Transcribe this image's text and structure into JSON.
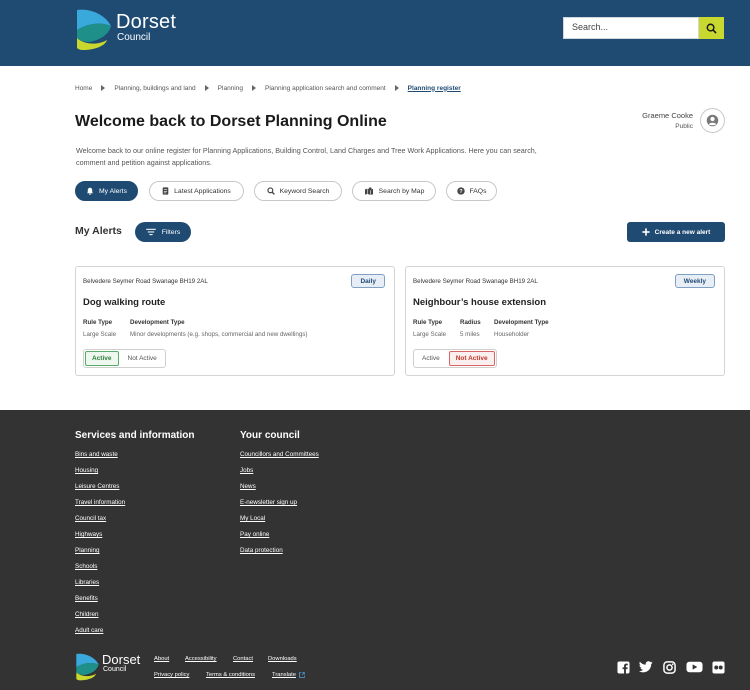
{
  "header": {
    "logo_word1": "Dorset",
    "logo_word2": "Council",
    "search_placeholder": "Search...",
    "search_icon": "search-icon"
  },
  "breadcrumb": [
    "Home",
    "Planning, buildings and land",
    "Planning",
    "Planning application search and comment",
    "Planning register"
  ],
  "page": {
    "title": "Welcome back to Dorset Planning Online",
    "intro": "Welcome back to our online register for Planning Applications, Building Control, Land Charges and Tree Work Applications. Here you can search, comment and petition against applications."
  },
  "user": {
    "name": "Graeme Cooke",
    "role": "Public",
    "icon": "user-circle-icon"
  },
  "tabs": [
    {
      "label": "My Alerts",
      "icon": "bell-icon",
      "active": true
    },
    {
      "label": "Latest Applications",
      "icon": "document-icon",
      "active": false
    },
    {
      "label": "Keyword Search",
      "icon": "search-icon",
      "active": false
    },
    {
      "label": "Search by Map",
      "icon": "map-icon",
      "active": false
    },
    {
      "label": "FAQs",
      "icon": "question-icon",
      "active": false
    }
  ],
  "alerts": {
    "title": "My Alerts",
    "filters_label": "Filters",
    "create_label": "Create a new alert",
    "cards": [
      {
        "address": "Belvedere Seymer Road Swanage BH19 2AL",
        "frequency": "Daily",
        "title": "Dog walking route",
        "meta": [
          {
            "label": "Rule Type",
            "value": "Large Scale"
          },
          {
            "label": "Development Type",
            "value": "Minor developments (e.g. shops, commercial and new dwellings)"
          }
        ],
        "active_label": "Active",
        "inactive_label": "Not Active",
        "state": "active"
      },
      {
        "address": "Belvedere Seymer Road Swanage BH19 2AL",
        "frequency": "Weekly",
        "title": "Neighbour’s house extension",
        "meta": [
          {
            "label": "Rule Type",
            "value": "Large Scale"
          },
          {
            "label": "Radius",
            "value": "5 miles"
          },
          {
            "label": "Development Type",
            "value": "Householder"
          }
        ],
        "active_label": "Active",
        "inactive_label": "Not Active",
        "state": "inactive"
      }
    ]
  },
  "footer": {
    "col1": {
      "heading": "Services and information",
      "links": [
        "Bins and waste",
        "Housing",
        "Leisure Centres",
        "Travel information",
        "Council tax",
        "Highways",
        "Planning",
        "Schools",
        "Libraries",
        "Benefits",
        "Children",
        "Adult care"
      ]
    },
    "col2": {
      "heading": "Your council",
      "links": [
        "Councillors and Committees",
        "Jobs",
        "News",
        "E-newsletter sign up",
        "My Local",
        "Pay online",
        "Data protection"
      ]
    },
    "logo_word1": "Dorset",
    "logo_word2": "Council",
    "small_row1": [
      "About",
      "Accessibility",
      "Contact",
      "Downloads"
    ],
    "small_row2": [
      "Privacy policy",
      "Terms & conditions",
      "Translate"
    ],
    "social": [
      "facebook-icon",
      "twitter-icon",
      "instagram-icon",
      "youtube-icon",
      "flickr-icon"
    ]
  },
  "colors": {
    "brand_blue": "#1f4b73",
    "accent_lime": "#c8d82e",
    "footer_bg": "#333333",
    "active_green": "#2f7d3b",
    "inactive_red": "#c0392b"
  }
}
